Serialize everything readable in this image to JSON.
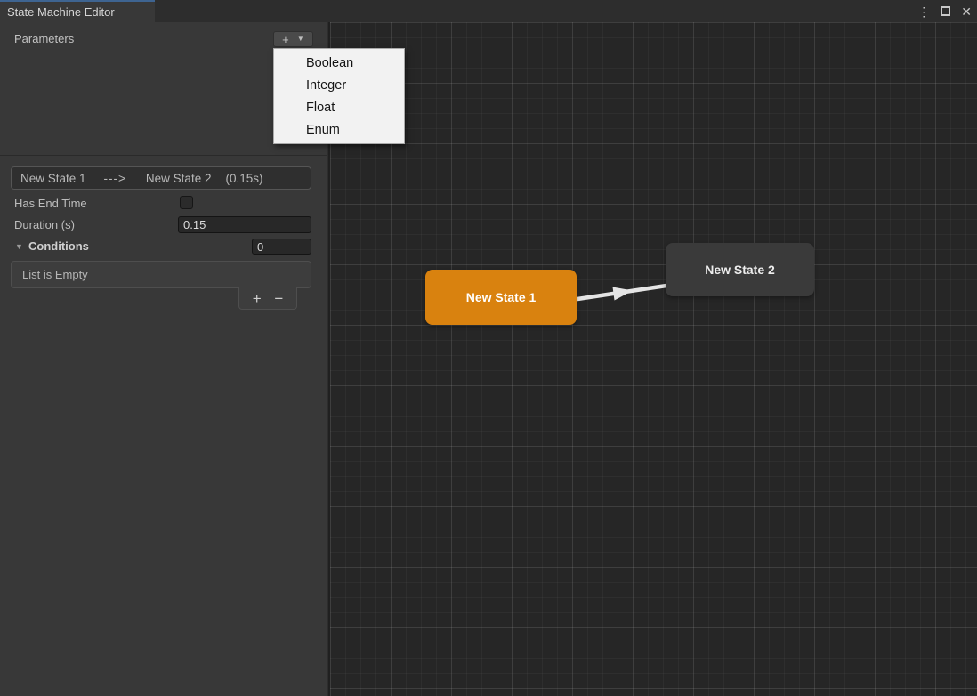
{
  "window": {
    "title_tab": "State Machine Editor",
    "icons": {
      "menu": "⋮",
      "close": "✕"
    }
  },
  "sidebar": {
    "parameters_label": "Parameters",
    "add_param_button": {
      "plus": "+",
      "caret": "▼"
    },
    "type_menu": {
      "items": [
        "Boolean",
        "Integer",
        "Float",
        "Enum"
      ]
    },
    "transition": {
      "from": "New State 1",
      "arrow": "--->",
      "to": "New State 2",
      "duration_tag": "(0.15s)",
      "has_end_time_label": "Has End Time",
      "has_end_time_checked": false,
      "duration_label": "Duration (s)",
      "duration_value": "0.15",
      "foldout_caret": "▼",
      "conditions_label": "Conditions",
      "conditions_count": "0",
      "list_empty_text": "List is Empty",
      "add_label": "+",
      "remove_label": "−"
    }
  },
  "canvas": {
    "nodes": [
      {
        "label": "New State 1",
        "color": "#d9820f"
      },
      {
        "label": "New State 2",
        "color": "#3a3a3a"
      }
    ],
    "edge": {
      "from": "New State 1",
      "to": "New State 2",
      "color": "#e4e4e4"
    }
  },
  "colors": {
    "accent_blue": "#3e6491",
    "panel_bg": "#383838",
    "titlebar_bg": "#2d2d2d",
    "canvas_bg": "#262626",
    "node_orange": "#d9820f",
    "menu_bg": "#f2f2f2"
  }
}
